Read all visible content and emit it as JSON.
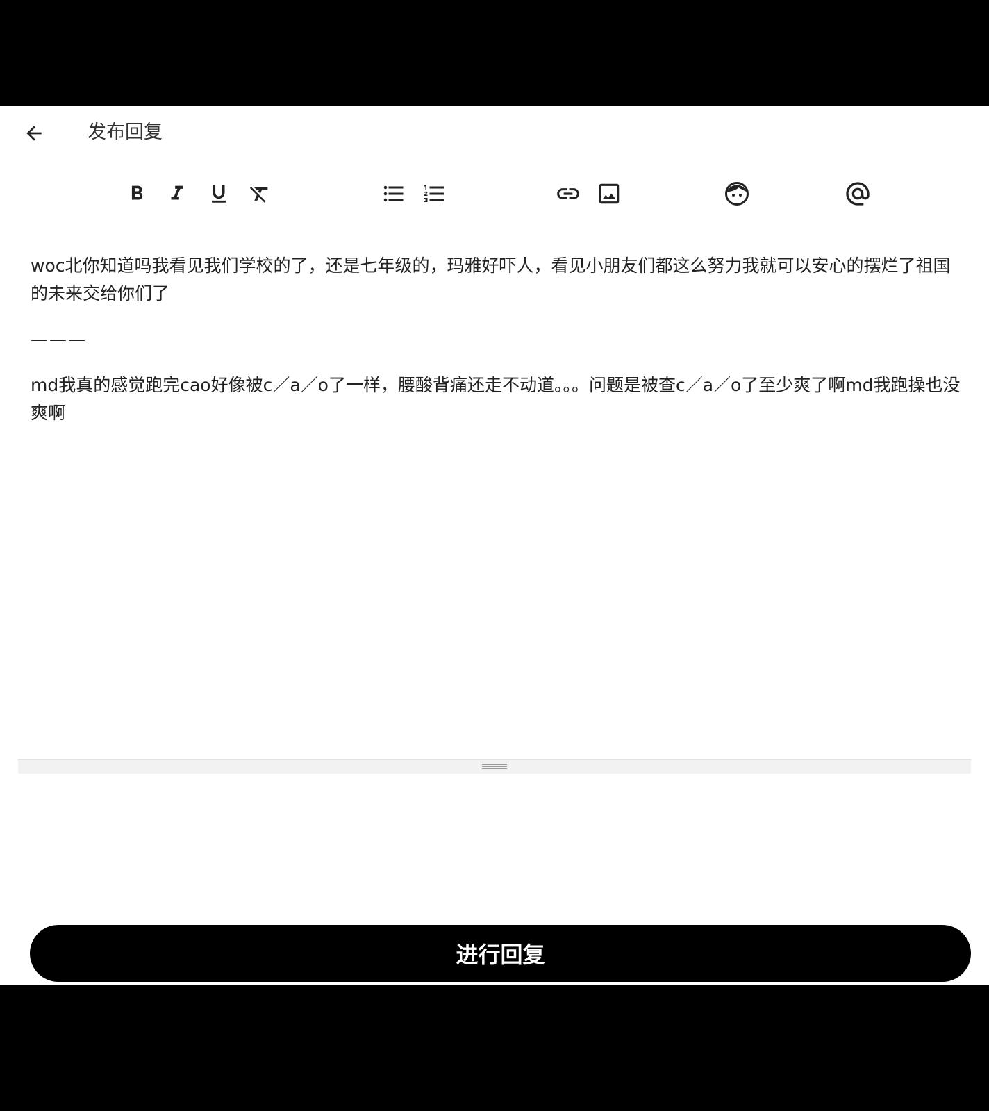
{
  "header": {
    "title": "发布回复",
    "back_icon": "arrow-left-icon"
  },
  "toolbar": {
    "groups": [
      [
        "bold-icon",
        "italic-icon",
        "underline-icon",
        "clear-format-icon"
      ],
      [
        "bullet-list-icon",
        "numbered-list-icon"
      ],
      [
        "link-icon",
        "image-icon"
      ],
      [
        "emoji-icon"
      ],
      [
        "mention-icon"
      ]
    ]
  },
  "editor": {
    "paragraph_1": "woc北你知道吗我看见我们学校的了，还是七年级的，玛雅好吓人，看见小朋友们都这么努力我就可以安心的摆烂了祖国的未来交给你们了",
    "divider": "———",
    "paragraph_2": "md我真的感觉跑完cao好像被c／a／o了一样，腰酸背痛还走不动道。。。问题是被查c／a／o了至少爽了啊md我跑操也没爽啊"
  },
  "submit": {
    "label": "进行回复"
  },
  "colors": {
    "background": "#ffffff",
    "frame": "#000000",
    "button": "#000000",
    "button_text": "#ffffff",
    "resize_bar": "#f2f2f2"
  }
}
